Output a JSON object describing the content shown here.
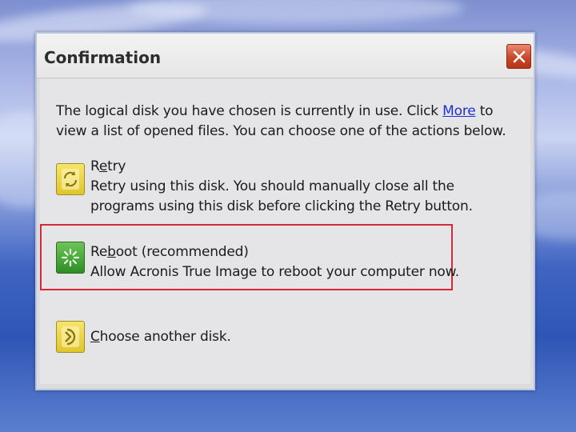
{
  "dialog": {
    "title": "Confirmation",
    "intro_before_link": "The logical disk you have chosen is currently in use. Click ",
    "intro_link": "More",
    "intro_after_link": " to view a list of opened files. You can choose one of the actions below."
  },
  "options": [
    {
      "title_first": "R",
      "title_underlined": "e",
      "title_rest": "try",
      "description": "Retry using this disk. You should manually close all the programs using this disk before clicking the Retry button.",
      "icon": "retry-icon"
    },
    {
      "title_first": "Re",
      "title_underlined": "b",
      "title_rest": "oot (recommended)",
      "description": "Allow Acronis True Image to reboot your computer now.",
      "icon": "reboot-icon",
      "highlighted": true
    },
    {
      "title_first": "",
      "title_underlined": "C",
      "title_rest": "hoose another disk.",
      "description": "",
      "icon": "choose-disk-icon"
    }
  ],
  "colors": {
    "highlight_border": "#d7283a",
    "link": "#1f2fd0",
    "close_button": "#c9482a"
  }
}
